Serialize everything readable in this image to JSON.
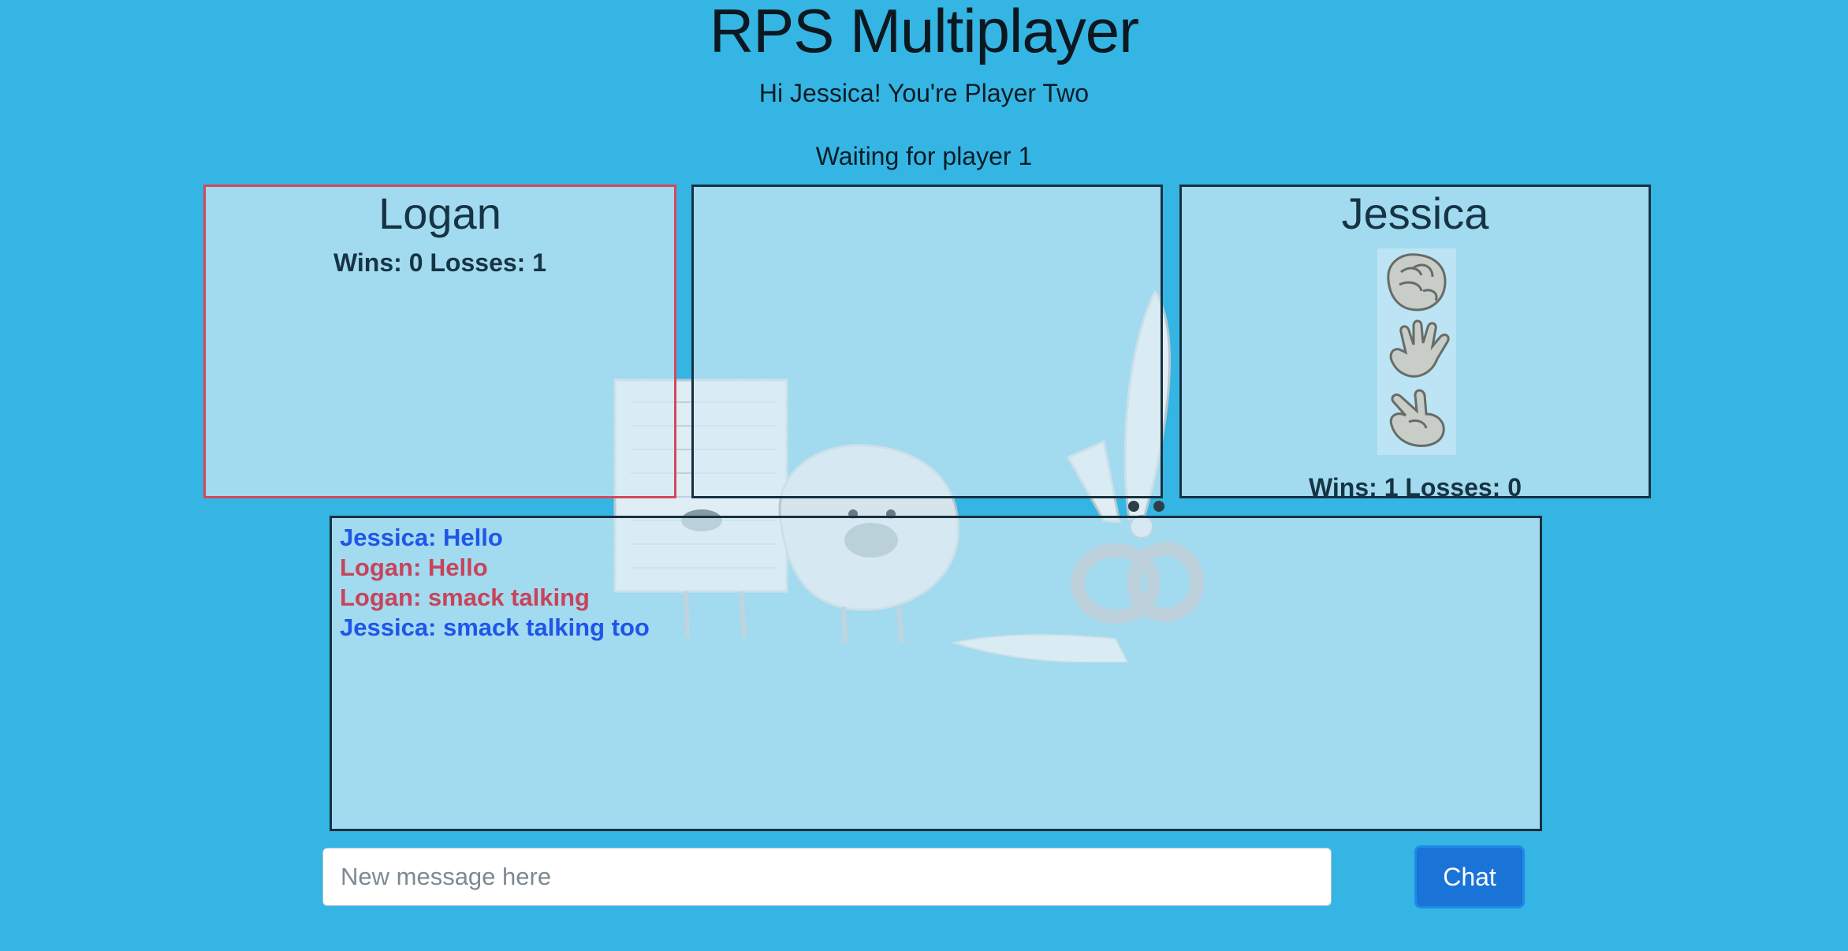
{
  "header": {
    "title": "RPS Multiplayer",
    "greeting": "Hi Jessica! You're Player Two",
    "status": "Waiting for player 1"
  },
  "players": {
    "one": {
      "name": "Logan",
      "record": "Wins: 0 Losses: 1"
    },
    "two": {
      "name": "Jessica",
      "record": "Wins: 1 Losses: 0"
    }
  },
  "choices": [
    "rock-icon",
    "paper-icon",
    "scissors-icon"
  ],
  "chat": {
    "messages": [
      {
        "text": "Jessica: Hello",
        "player": "two"
      },
      {
        "text": "Logan: Hello",
        "player": "one"
      },
      {
        "text": "Logan: smack talking",
        "player": "one"
      },
      {
        "text": "Jessica: smack talking too",
        "player": "two"
      }
    ],
    "input_placeholder": "New message here",
    "button_label": "Chat"
  },
  "colors": {
    "background": "#35b5e3",
    "player_one": "#c8435a",
    "player_two": "#1f55e8",
    "button": "#1a73d6"
  }
}
